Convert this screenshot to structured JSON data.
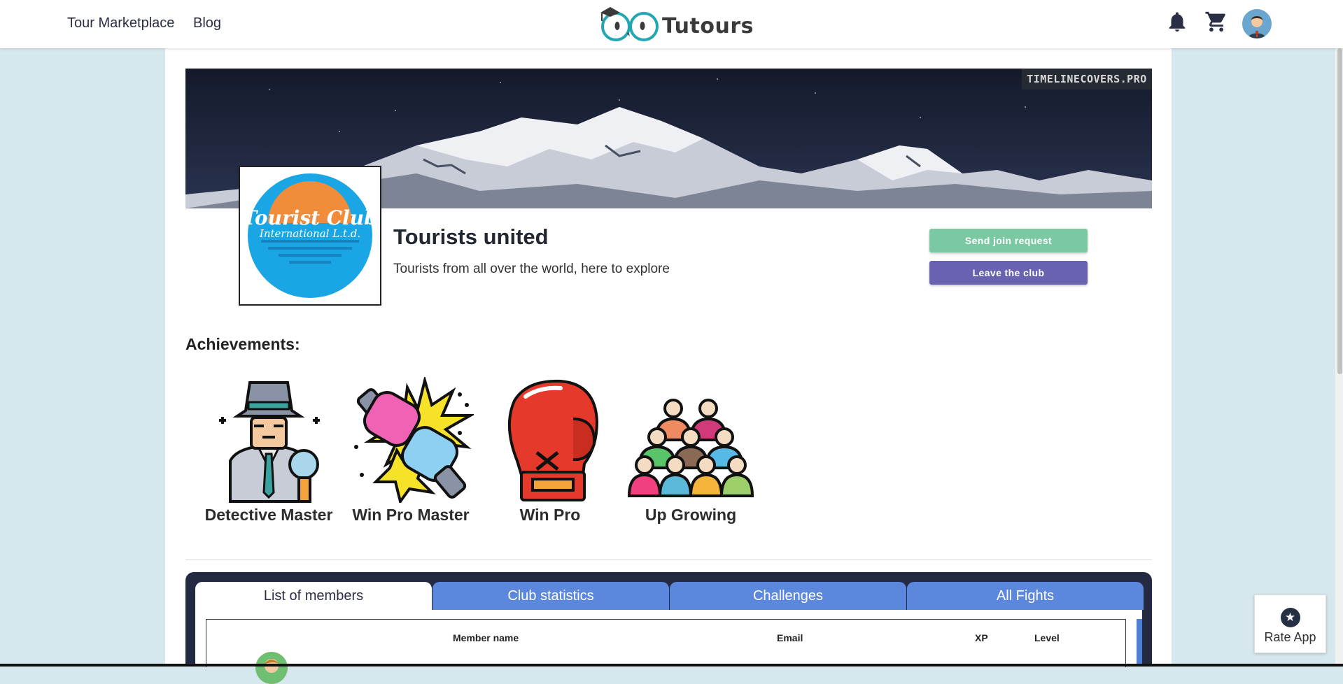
{
  "navbar": {
    "links": [
      "Tour Marketplace",
      "Blog"
    ],
    "brand": "Tutours",
    "icons": [
      "bell-icon",
      "cart-icon",
      "user-avatar"
    ]
  },
  "club": {
    "cover_watermark": "TIMELINECOVERS.PRO",
    "logo_text_line1": "Tourist Club",
    "logo_text_line2": "International L.t.d.",
    "name": "Tourists united",
    "description": "Tourists from all over the world, here to explore"
  },
  "actions": {
    "join_label": "Send join request",
    "leave_label": "Leave the club"
  },
  "achievements": {
    "heading": "Achievements:",
    "items": [
      {
        "label": "Detective Master",
        "icon": "detective-icon"
      },
      {
        "label": "Win Pro Master",
        "icon": "boxing-clash-icon"
      },
      {
        "label": "Win Pro",
        "icon": "boxing-glove-icon"
      },
      {
        "label": "Up Growing",
        "icon": "crowd-icon"
      }
    ]
  },
  "tabs": [
    {
      "label": "List of members",
      "active": true
    },
    {
      "label": "Club statistics",
      "active": false
    },
    {
      "label": "Challenges",
      "active": false
    },
    {
      "label": "All Fights",
      "active": false
    }
  ],
  "members_table": {
    "columns": [
      "Member name",
      "Email",
      "XP",
      "Level"
    ]
  },
  "rate_app": {
    "label": "Rate App"
  },
  "colors": {
    "page_background": "#d6e8ee",
    "join_button": "#7bc9a3",
    "leave_button": "#6862b1",
    "tab_inactive": "#5b87dc",
    "tabs_panel": "#242a42",
    "brand_teal": "#23a6b4"
  }
}
